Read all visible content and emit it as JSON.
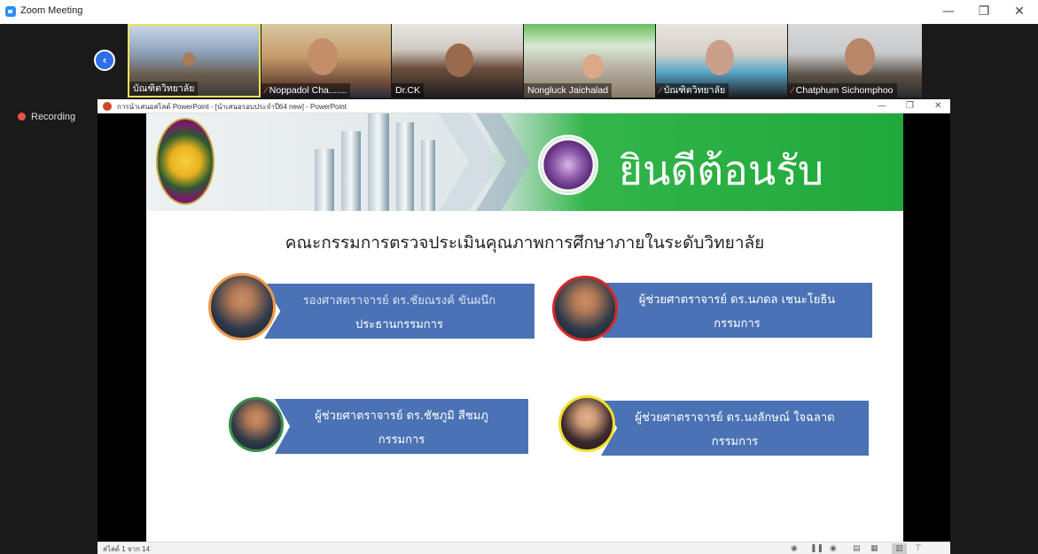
{
  "window": {
    "title": "Zoom Meeting",
    "minimize": "—",
    "restore": "❐",
    "close": "✕"
  },
  "recording": {
    "label": "Recording"
  },
  "participants": [
    {
      "name": "บัณฑิตวิทยาลัย",
      "muted": false
    },
    {
      "name": "Noppadol  Cha.......",
      "muted": true
    },
    {
      "name": "Dr.CK",
      "muted": false
    },
    {
      "name": "Nongluck Jaichalad",
      "muted": false
    },
    {
      "name": "บัณฑิตวิทยาลัย",
      "muted": true
    },
    {
      "name": "Chatphum Sichomphoo",
      "muted": true
    }
  ],
  "powerpoint": {
    "title": "การนำเสนอสไลด์ PowerPoint - [นำเสนอรอบประจำปี64 new] - PowerPoint",
    "slide_counter": "สไลด์ 1 จาก 14"
  },
  "slide": {
    "welcome": "ยินดีต้อนรับ",
    "headline": "คณะกรรมการตรวจประเมินคุณภาพการศึกษาภายในระดับวิทยาลัย",
    "members": [
      {
        "name": "รองศาสตราจารย์ ดร.ชัยณรงค์ ขันผนึก",
        "role": "ประธานกรรมการ"
      },
      {
        "name": "ผู้ช่วยศาตราจารย์ ดร.นภดล เชนะโยธิน",
        "role": "กรรมการ"
      },
      {
        "name": "ผู้ช่วยศาตราจารย์ ดร.ชัชภูมิ สีชมภู",
        "role": "กรรมการ"
      },
      {
        "name": "ผู้ช่วยศาตราจารย์ ดร.นงลักษณ์ ใจฉลาด",
        "role": "กรรมการ"
      }
    ]
  },
  "colors": {
    "accent": "#2d8cff",
    "slide_box": "#4a72b5",
    "banner_green": "#1fa83b"
  }
}
